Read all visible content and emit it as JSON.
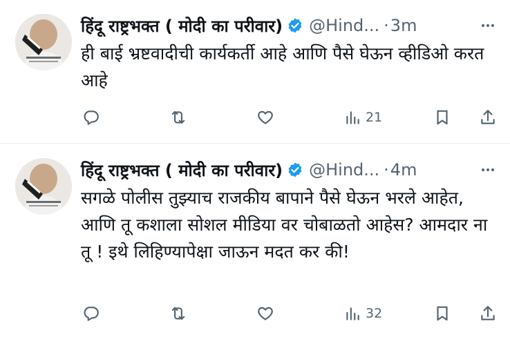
{
  "tweets": [
    {
      "name": "हिंदू राष्ट्रभक्त ( मोदी का परीवार)",
      "handle": "@Hind...",
      "separator": "·",
      "time": "3m",
      "text": "ही बाई भ्रष्टवादीची कार्यकर्ती आहे आणि पैसे घेऊन व्हीडिओ करत आहे",
      "views": "21"
    },
    {
      "name": "हिंदू राष्ट्रभक्त ( मोदी का परीवार)",
      "handle": "@Hind...",
      "separator": "·",
      "time": "4m",
      "text": "सगळे पोलीस तुझ्याच राजकीय बापाने पैसे घेऊन भरले आहेत, आणि तू कशाला सोशल मीडिया वर चोबाळतो आहेस? आमदार ना तू ! इथे लिहिण्यापेक्षा जाऊन मदत कर की!",
      "views": "32"
    }
  ],
  "icons": {
    "verified": "verified-badge-icon",
    "more": "more-options-icon",
    "reply": "reply-icon",
    "retweet": "retweet-icon",
    "like": "heart-icon",
    "views": "views-chart-icon",
    "bookmark": "bookmark-icon",
    "share": "share-icon"
  },
  "colors": {
    "verified": "#1d9bf0",
    "secondary_text": "#536471",
    "primary_text": "#0f1419"
  }
}
